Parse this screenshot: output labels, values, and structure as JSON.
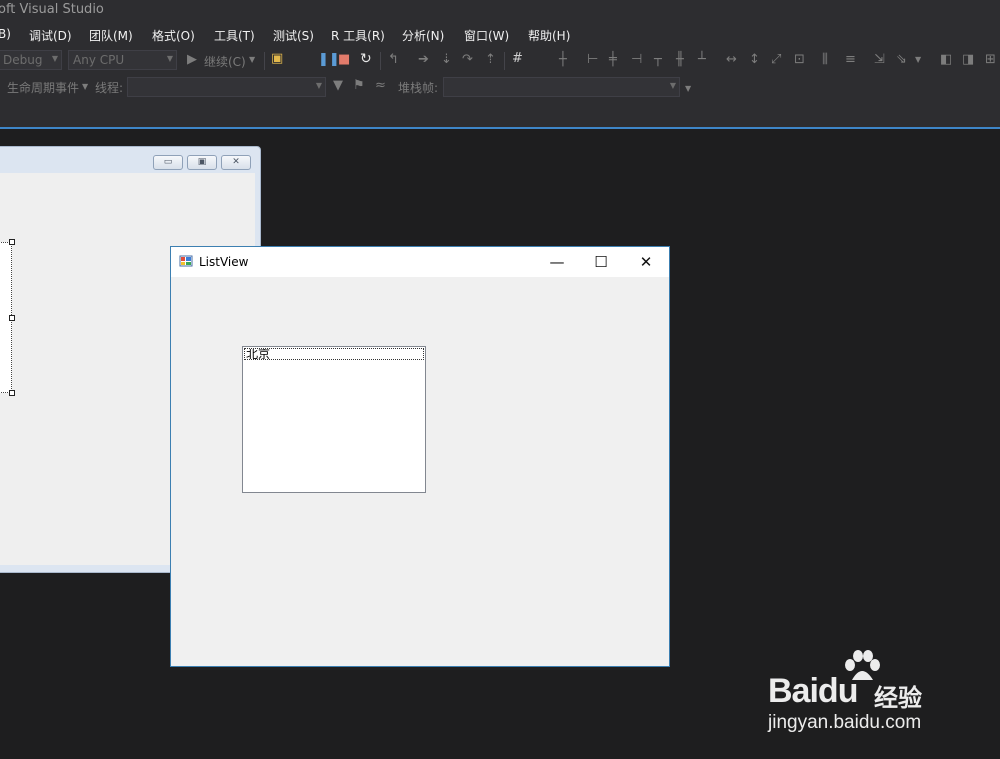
{
  "vs": {
    "title": "oft Visual Studio",
    "menu": [
      "B)",
      "调试(D)",
      "团队(M)",
      "格式(O)",
      "工具(T)",
      "测试(S)",
      "R 工具(R)",
      "分析(N)",
      "窗口(W)",
      "帮助(H)"
    ],
    "config_combo": "Debug",
    "platform_combo": "Any CPU",
    "continue_label": "继续(C)",
    "lifecycle_label": "生命周期事件",
    "thread_label": "线程:",
    "stackframe_label": "堆栈帧:"
  },
  "designer": {
    "minimize": "▭",
    "restore": "▣",
    "close": "✕"
  },
  "window": {
    "title": "ListView",
    "minimize": "—",
    "maximize": "☐",
    "close": "✕",
    "icon": "app-icon",
    "listview_items": [
      "北京"
    ]
  },
  "watermark": {
    "brand": "Bai",
    "brand_tail": "du",
    "cn": "经验",
    "url": "jingyan.baidu.com"
  }
}
